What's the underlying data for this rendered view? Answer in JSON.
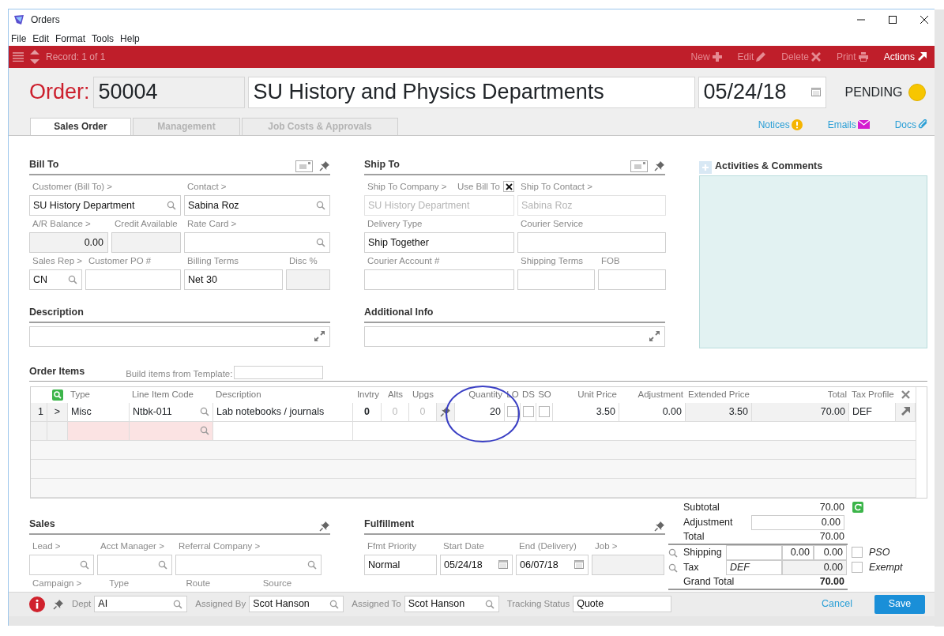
{
  "window": {
    "title": "Orders"
  },
  "menu": [
    "File",
    "Edit",
    "Format",
    "Tools",
    "Help"
  ],
  "toolbar": {
    "record": "Record: 1 of 1",
    "actions": [
      {
        "label": "New",
        "kind": "new",
        "disabled": true
      },
      {
        "label": "Edit",
        "kind": "edit",
        "disabled": true
      },
      {
        "label": "Delete",
        "kind": "delete",
        "disabled": true
      },
      {
        "label": "Print",
        "kind": "print",
        "disabled": true
      },
      {
        "label": "Actions",
        "kind": "actions",
        "disabled": false
      }
    ]
  },
  "header": {
    "label": "Order:",
    "number": "50004",
    "name": "SU History and Physics Departments",
    "date": "05/24/18",
    "status": "PENDING"
  },
  "tabs": [
    {
      "label": "Sales Order",
      "selected": true
    },
    {
      "label": "Management",
      "selected": false
    },
    {
      "label": "Job Costs & Approvals",
      "selected": false
    }
  ],
  "links": [
    {
      "label": "Notices",
      "kind": "notice"
    },
    {
      "label": "Emails",
      "kind": "email"
    },
    {
      "label": "Docs",
      "kind": "docs"
    }
  ],
  "bill_to": {
    "title": "Bill To",
    "fields": [
      {
        "label": "Customer (Bill To) >",
        "value": "SU History Department",
        "kind": "lookup"
      },
      {
        "label": "Contact >",
        "value": "Sabina Roz",
        "kind": "lookup"
      },
      {
        "label": "A/R Balance >",
        "value": "0.00",
        "kind": "readonly"
      },
      {
        "label": "Credit Available",
        "kind": "readonly"
      },
      {
        "label": "Rate Card >",
        "kind": "lookup"
      },
      {
        "label": "Sales Rep >",
        "value": "CN",
        "kind": "lookup"
      },
      {
        "label": "Customer PO #",
        "kind": "text"
      },
      {
        "label": "Billing Terms",
        "value": "Net 30",
        "kind": "text"
      },
      {
        "label": "Disc %",
        "kind": "readonly"
      }
    ]
  },
  "ship_to": {
    "title": "Ship To",
    "use_bill_to": {
      "label": "Use Bill To",
      "checked": true
    },
    "fields": [
      {
        "label": "Ship To Company >",
        "value": "SU History Department",
        "kind": "text",
        "disabled": true
      },
      {
        "label": "Ship To Contact >",
        "value": "Sabina Roz",
        "kind": "text",
        "disabled": true
      },
      {
        "label": "Delivery Type",
        "value": "Ship Together",
        "kind": "text",
        "disabled": false
      },
      {
        "label": "Courier Service",
        "kind": "text",
        "disabled": false
      },
      {
        "label": "Courier Account #",
        "kind": "text",
        "disabled": false
      },
      {
        "label": "Shipping Terms",
        "kind": "text",
        "disabled": false
      },
      {
        "label": "FOB",
        "kind": "text",
        "disabled": false
      }
    ]
  },
  "activities": {
    "title": "Activities & Comments"
  },
  "description": {
    "title": "Description"
  },
  "additional_info": {
    "title": "Additional Info"
  },
  "order_items": {
    "title": "Order Items",
    "template_label": "Build items from Template:",
    "columns": [
      "Type",
      "Line Item Code",
      "Description",
      "Invtry",
      "Alts",
      "Upgs",
      "Quantity",
      "LO",
      "DS",
      "SO",
      "Unit Price",
      "Adjustment",
      "Extended Price",
      "Total",
      "Tax Profile"
    ],
    "rows": [
      {
        "num": "1",
        "marker": ">",
        "type": "Misc",
        "code": "Ntbk-011",
        "description": "Lab notebooks / journals",
        "invtry": "0",
        "alts": "0",
        "upgs": "0",
        "quantity": "20",
        "circled": true,
        "lo": false,
        "ds": false,
        "so": false,
        "unit_price": "3.50",
        "adjustment": "0.00",
        "extended_price": "3.50",
        "total": "70.00",
        "tax_profile": "DEF"
      }
    ],
    "entry_row": {
      "required": true
    }
  },
  "sales": {
    "title": "Sales",
    "fields": [
      {
        "label": "Lead >",
        "kind": "lookup"
      },
      {
        "label": "Acct Manager >",
        "kind": "lookup"
      },
      {
        "label": "Referral Company >",
        "kind": "lookup"
      }
    ],
    "more_labels": [
      "Campaign >",
      "Type",
      "Route",
      "Source"
    ]
  },
  "fulfillment": {
    "title": "Fulfillment",
    "fields": [
      {
        "label": "Ffmt Priority",
        "value": "Normal",
        "kind": "text"
      },
      {
        "label": "Start Date",
        "value": "05/24/18",
        "kind": "date"
      },
      {
        "label": "End (Delivery)",
        "value": "06/07/18",
        "kind": "date"
      },
      {
        "label": "Job >",
        "kind": "readonly"
      }
    ]
  },
  "totals": {
    "subtotal": {
      "label": "Subtotal",
      "value": "70.00"
    },
    "adjustment": {
      "label": "Adjustment",
      "value": "0.00"
    },
    "total": {
      "label": "Total",
      "value": "70.00"
    },
    "shipping": {
      "label": "Shipping",
      "values": [
        "0.00",
        "0.00"
      ],
      "option": {
        "label": "PSO",
        "checked": false
      }
    },
    "tax": {
      "label": "Tax",
      "profile": "DEF",
      "value": "0.00",
      "option": {
        "label": "Exempt",
        "checked": false
      }
    },
    "grand_total": {
      "label": "Grand Total",
      "value": "70.00"
    }
  },
  "footer": {
    "fields": [
      {
        "label": "Dept",
        "value": "AI",
        "kind": "lookup"
      },
      {
        "label": "Assigned By",
        "value": "Scot Hanson",
        "kind": "lookup"
      },
      {
        "label": "Assigned To",
        "value": "Scot Hanson",
        "kind": "lookup"
      },
      {
        "label": "Tracking Status",
        "value": "Quote",
        "kind": "text"
      }
    ],
    "cancel": "Cancel",
    "save": "Save"
  }
}
